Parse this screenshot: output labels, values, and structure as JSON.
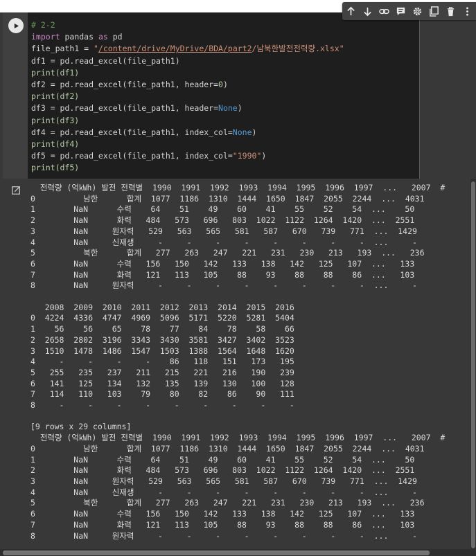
{
  "code_lines": [
    "# 2-2",
    "import pandas as pd",
    "file_path1 = \"/content/drive/MyDrive/BDA/part2/남북한발전전력량.xlsx\"",
    "df1 = pd.read_excel(file_path1)",
    "print(df1)",
    "df2 = pd.read_excel(file_path1, header=0)",
    "print(df2)",
    "df3 = pd.read_excel(file_path1, header=None)",
    "print(df3)",
    "df4 = pd.read_excel(file_path1, index_col=None)",
    "print(df4)",
    "df5 = pd.read_excel(file_path1, index_col=\"1990\")",
    "print(df5)"
  ],
  "output_lines": [
    "  전력량 (억㎾h) 발전 전력별  1990  1991  1992  1993  1994  1995  1996  1997  ...   2007  #",
    "0          남한      합계  1077  1186  1310  1444  1650  1847  2055  2244  ...  4031",
    "1        NaN      수력    64    51    49    60    41    55    52    54  ...    50",
    "2        NaN      화력   484   573   696   803  1022  1122  1264  1420  ...  2551",
    "3        NaN     원자력   529   563   565   581   587   670   739   771  ...  1429",
    "4        NaN     신재생     -     -     -     -     -     -     -     -  ...     -",
    "5          북한      합계   277   263   247   221   231   230   213   193  ...   236",
    "6        NaN      수력   156   150   142   133   138   142   125   107  ...   133",
    "7        NaN      화력   121   113   105    88    93    88    88    86  ...   103",
    "8        NaN     원자력     -     -     -     -     -     -     -     -  ...     -",
    "",
    "   2008  2009  2010  2011  2012  2013  2014  2015  2016",
    "0  4224  4336  4747  4969  5096  5171  5220  5281  5404",
    "1    56    56    65    78    77    84    78    58    66",
    "2  2658  2802  3196  3343  3430  3581  3427  3402  3523",
    "3  1510  1478  1486  1547  1503  1388  1564  1648  1620",
    "4     -     -     -     -    86   118   151   173   195",
    "5   255   235   237   211   215   221   216   190   239",
    "6   141   125   134   132   135   139   130   100   128",
    "7   114   110   103    79    80    82    86    90   111",
    "8     -     -     -     -     -     -     -     -     -",
    "",
    "[9 rows x 29 columns]",
    "  전력량 (억㎾h) 발전 전력별  1990  1991  1992  1993  1994  1995  1996  1997  ...   2007  #",
    "0          남한      합계  1077  1186  1310  1444  1650  1847  2055  2244  ...  4031",
    "1        NaN      수력    64    51    49    60    41    55    52    54  ...    50",
    "2        NaN      화력   484   573   696   803  1022  1122  1264  1420  ...  2551",
    "3        NaN     원자력   529   563   565   581   587   670   739   771  ...  1429",
    "4        NaN     신재생     -     -     -     -     -     -     -     -  ...     -",
    "5          북한      합계   277   263   247   221   231   230   213   193  ...   236",
    "6        NaN      수력   156   150   142   133   138   142   125   107  ...   133",
    "7        NaN      화력   121   113   105    88    93    88    88    86  ...   103",
    "8        NaN     원자력     -     -     -     -     -     -     -     -  ...     -"
  ]
}
